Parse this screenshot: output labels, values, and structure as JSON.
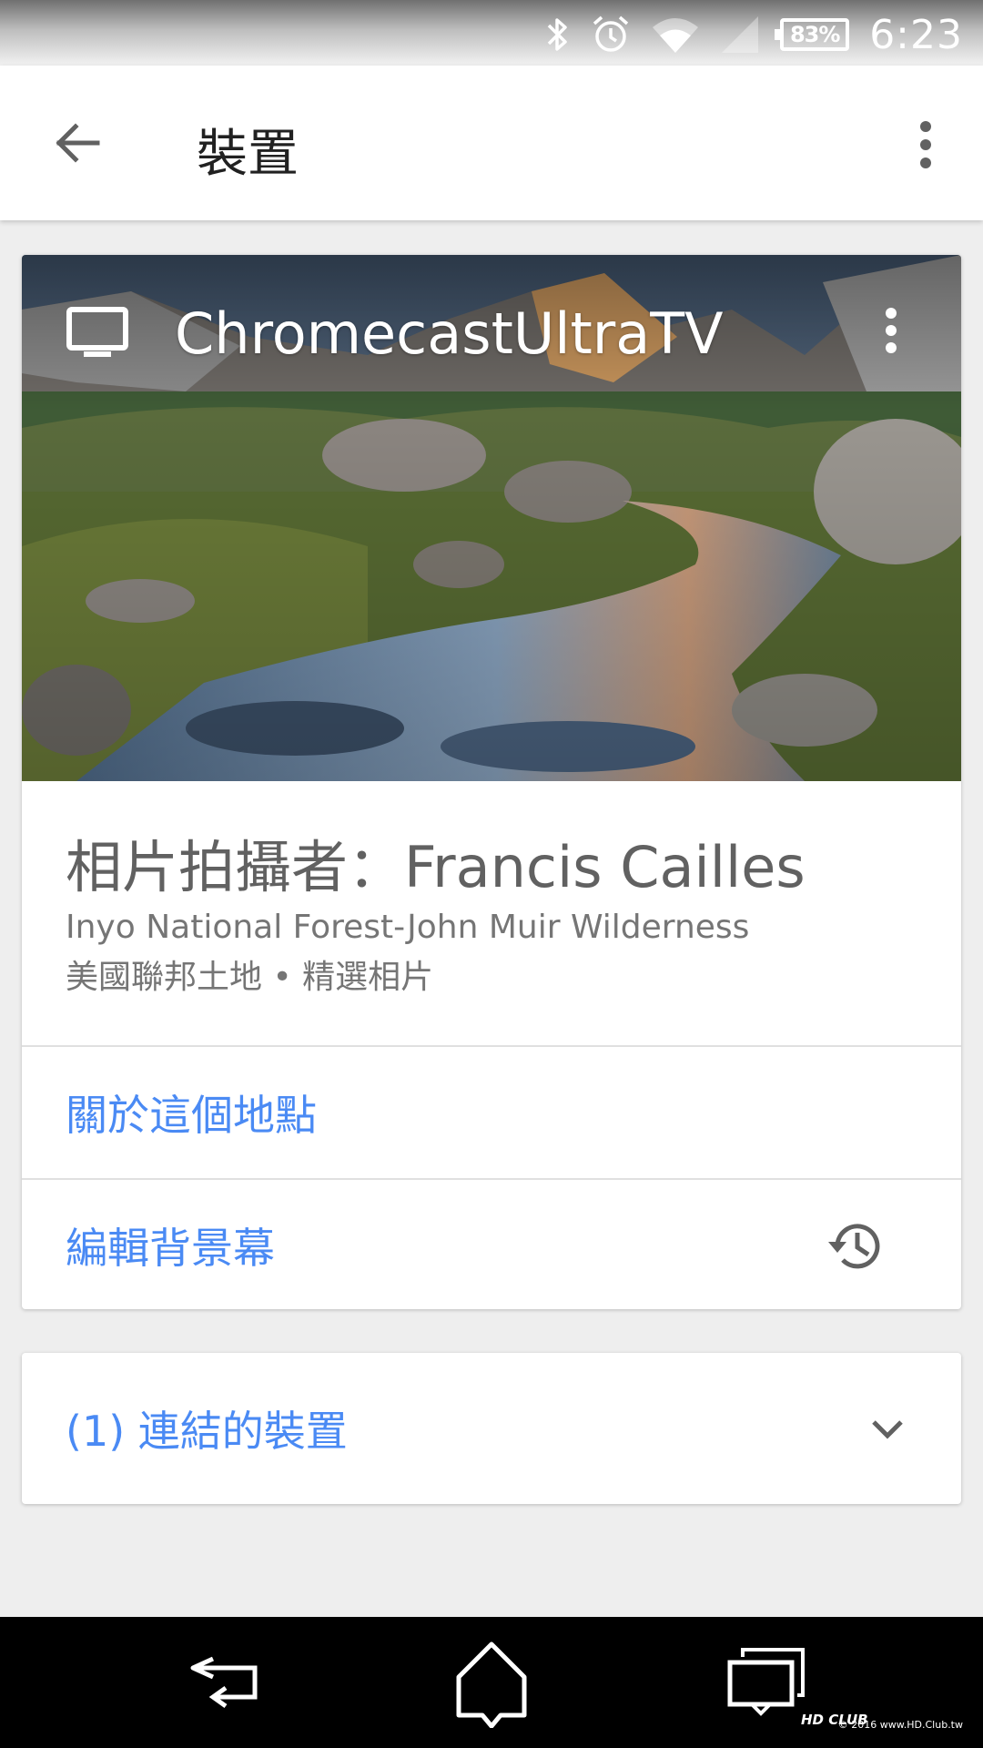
{
  "status_bar": {
    "battery_percent": "83%",
    "time": "6:23",
    "icons": [
      "bluetooth-icon",
      "alarm-icon",
      "wifi-icon",
      "cell-signal-icon",
      "battery-icon"
    ]
  },
  "app_bar": {
    "title": "裝置",
    "back_icon": "arrow-back-icon",
    "menu_icon": "more-vert-icon"
  },
  "device_card": {
    "device_name": "ChromecastUltraTV",
    "device_icon": "tv-icon",
    "menu_icon": "more-vert-icon",
    "photo_credit": "相片拍攝者：Francis Cailles",
    "photo_location": "Inyo National Forest-John Muir Wilderness",
    "photo_source": "美國聯邦土地 • 精選相片",
    "about_place_label": "關於這個地點",
    "edit_backdrop_label": "編輯背景幕",
    "history_icon": "history-icon",
    "link_color": "#4a8af4"
  },
  "linked_devices": {
    "label": "(1) 連結的裝置",
    "toggle_icon": "chevron-down-icon"
  },
  "nav_bar": {
    "icons": [
      "nav-back-icon",
      "nav-home-icon",
      "nav-recents-icon"
    ],
    "watermark_logo": "HD CLUB",
    "watermark": "© 2016 www.HD.Club.tw"
  }
}
